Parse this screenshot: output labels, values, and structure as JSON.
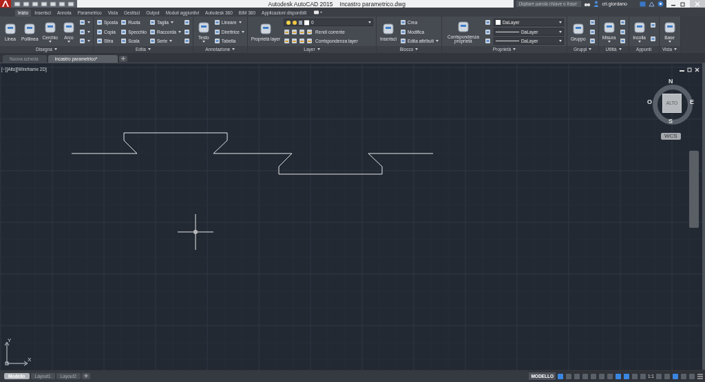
{
  "title_bar": {
    "app": "Autodesk AutoCAD 2015",
    "file": "Incastro parametrico.dwg",
    "search": {
      "placeholder": "Digitare parola chiave o frase"
    },
    "user": "cri.giordano"
  },
  "ribbon_tabs": [
    {
      "label": "Inizio",
      "selected": true
    },
    {
      "label": "Inserisci",
      "selected": false
    },
    {
      "label": "Annota",
      "selected": false
    },
    {
      "label": "Parametrico",
      "selected": false
    },
    {
      "label": "Vista",
      "selected": false
    },
    {
      "label": "Gestisci",
      "selected": false
    },
    {
      "label": "Output",
      "selected": false
    },
    {
      "label": "Moduli aggiuntivi",
      "selected": false
    },
    {
      "label": "Autodesk 360",
      "selected": false
    },
    {
      "label": "BIM 360",
      "selected": false
    },
    {
      "label": "Applicazioni disponibili",
      "selected": false
    }
  ],
  "panels": [
    {
      "title": "Disegna",
      "menu": true,
      "columns": [
        [
          {
            "kind": "large",
            "label": "Linea",
            "dropdown": false
          }
        ],
        [
          {
            "kind": "large",
            "label": "Polilinea",
            "dropdown": false
          }
        ],
        [
          {
            "kind": "large",
            "label": "Cerchio",
            "dropdown": true
          }
        ],
        [
          {
            "kind": "large",
            "label": "Arco",
            "dropdown": true
          }
        ],
        [
          {
            "kind": "icon",
            "dropdown": true
          },
          {
            "kind": "icon",
            "dropdown": true
          },
          {
            "kind": "icon",
            "dropdown": true
          }
        ]
      ]
    },
    {
      "title": "Edita",
      "menu": true,
      "columns": [
        [
          {
            "kind": "small",
            "label": "Sposta",
            "dropdown": false
          },
          {
            "kind": "small",
            "label": "Copia",
            "dropdown": false
          },
          {
            "kind": "small",
            "label": "Stira",
            "dropdown": false
          }
        ],
        [
          {
            "kind": "small",
            "label": "Ruota",
            "dropdown": false
          },
          {
            "kind": "small",
            "label": "Specchio",
            "dropdown": false
          },
          {
            "kind": "small",
            "label": "Scala",
            "dropdown": false
          }
        ],
        [
          {
            "kind": "small",
            "label": "Taglia",
            "dropdown": true
          },
          {
            "kind": "small",
            "label": "Raccorda",
            "dropdown": true
          },
          {
            "kind": "small",
            "label": "Serie",
            "dropdown": true
          }
        ],
        [
          {
            "kind": "icon",
            "dropdown": false
          },
          {
            "kind": "icon",
            "dropdown": false
          },
          {
            "kind": "icon",
            "dropdown": false
          }
        ]
      ]
    },
    {
      "title": "Annotazione",
      "menu": true,
      "columns": [
        [
          {
            "kind": "large",
            "label": "Testo",
            "dropdown": true
          }
        ],
        [
          {
            "kind": "small",
            "label": "Lineare",
            "dropdown": true
          },
          {
            "kind": "small",
            "label": "Direttrice",
            "dropdown": true
          },
          {
            "kind": "small",
            "label": "Tabella",
            "dropdown": false
          }
        ]
      ]
    },
    {
      "title": "Layer",
      "menu": true,
      "columns": [
        [
          {
            "kind": "large",
            "label": "Proprietà layer",
            "dropdown": false
          }
        ],
        [
          {
            "kind": "layer-select",
            "label": "0",
            "dropdown": true
          },
          {
            "kind": "tool-row",
            "label": "Rendi corrente"
          },
          {
            "kind": "tool-row",
            "label": "Corrispondenza layer"
          }
        ]
      ]
    },
    {
      "title": "Blocco",
      "menu": true,
      "columns": [
        [
          {
            "kind": "large",
            "label": "Inserisci",
            "dropdown": false
          }
        ],
        [
          {
            "kind": "small",
            "label": "Crea",
            "dropdown": false
          },
          {
            "kind": "small",
            "label": "Modifica",
            "dropdown": false
          },
          {
            "kind": "small",
            "label": "Edita attributi",
            "dropdown": true
          }
        ]
      ]
    },
    {
      "title": "Proprietà",
      "menu": true,
      "columns": [
        [
          {
            "kind": "large",
            "label": "Corrispondenza proprietà",
            "dropdown": false
          }
        ],
        [
          {
            "kind": "icon",
            "dropdown": false
          },
          {
            "kind": "icon",
            "dropdown": false
          },
          {
            "kind": "icon",
            "dropdown": false
          }
        ],
        [
          {
            "kind": "color-select",
            "label": "DaLayer",
            "dropdown": true
          },
          {
            "kind": "line-select",
            "label": "DaLayer",
            "dropdown": true
          },
          {
            "kind": "line-select",
            "label": "DaLayer",
            "dropdown": true
          }
        ]
      ]
    },
    {
      "title": "Gruppi",
      "menu": true,
      "columns": [
        [
          {
            "kind": "large",
            "label": "Gruppo",
            "dropdown": false
          }
        ],
        [
          {
            "kind": "icon",
            "dropdown": false
          },
          {
            "kind": "icon",
            "dropdown": false
          },
          {
            "kind": "icon",
            "dropdown": false
          }
        ]
      ]
    },
    {
      "title": "Utilità",
      "menu": true,
      "columns": [
        [
          {
            "kind": "large",
            "label": "Misura",
            "dropdown": true
          }
        ],
        [
          {
            "kind": "icon",
            "dropdown": false
          },
          {
            "kind": "icon",
            "dropdown": false
          },
          {
            "kind": "icon",
            "dropdown": false
          }
        ]
      ]
    },
    {
      "title": "Appunti",
      "menu": false,
      "columns": [
        [
          {
            "kind": "large",
            "label": "Incolla",
            "dropdown": true
          }
        ],
        [
          {
            "kind": "icon",
            "dropdown": false
          },
          {
            "kind": "icon",
            "dropdown": false
          }
        ]
      ]
    },
    {
      "title": "Vista",
      "menu": true,
      "columns": [
        [
          {
            "kind": "large",
            "label": "Base",
            "dropdown": true
          }
        ]
      ]
    }
  ],
  "file_tabs": [
    {
      "label": "Nuova scheda",
      "selected": false
    },
    {
      "label": "Incastro parametrico*",
      "selected": true
    }
  ],
  "viewport": {
    "label": "[−][Alto][Wireframe 2D]",
    "viewcube": {
      "face": "ALTO",
      "north": "N",
      "south": "S",
      "east": "E",
      "west": "O",
      "ucs_menu": "WCS"
    },
    "ucs": {
      "x": "X",
      "y": "Y"
    }
  },
  "layout_tabs": [
    {
      "label": "Modello",
      "selected": true
    },
    {
      "label": "Layout1",
      "selected": false
    },
    {
      "label": "Layout2",
      "selected": false
    }
  ],
  "status_bar": {
    "mode": "MODELLO",
    "scale": "1:1",
    "toggles": [
      {
        "on": true
      },
      {
        "on": false
      },
      {
        "on": false
      },
      {
        "on": false
      },
      {
        "on": false
      },
      {
        "on": false
      },
      {
        "on": false
      },
      {
        "on": true
      },
      {
        "on": true
      },
      {
        "on": false
      },
      {
        "on": false
      },
      {
        "on": false
      },
      {
        "on": false
      },
      {
        "on": true
      },
      {
        "on": false
      },
      {
        "on": false
      }
    ]
  }
}
